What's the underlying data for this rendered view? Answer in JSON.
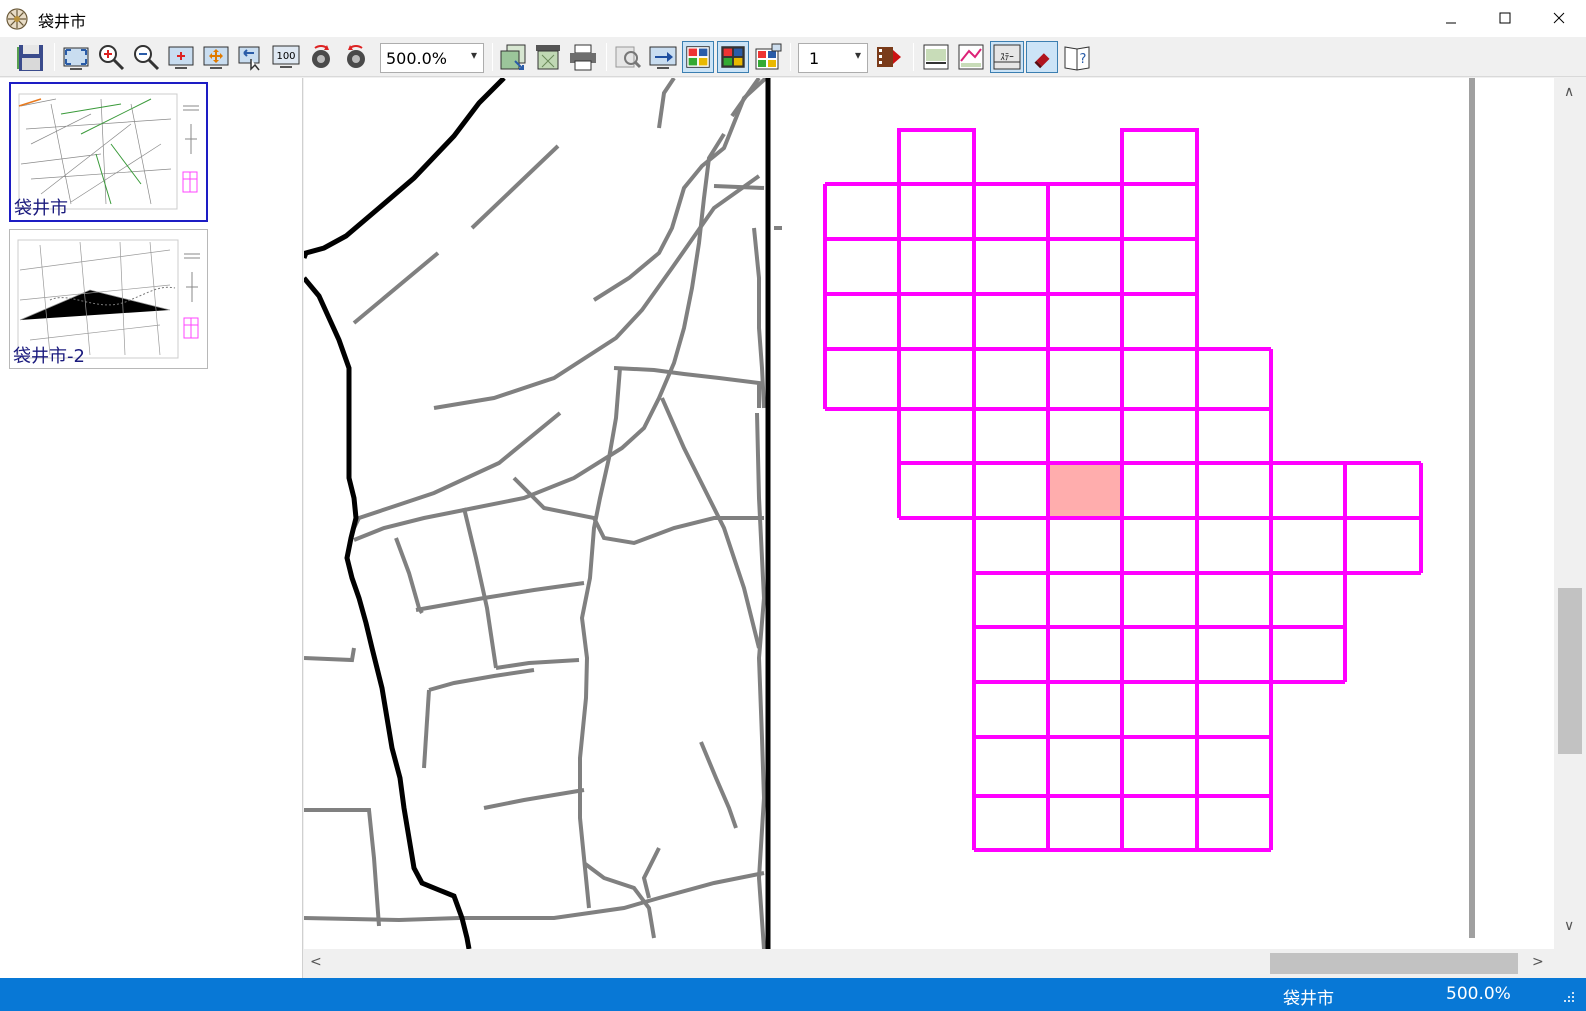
{
  "window": {
    "title": "袋井市",
    "minimize_glyph": "—",
    "maximize_glyph": "☐",
    "close_glyph": "✕"
  },
  "toolbar": {
    "buttons": [
      "save-icon",
      "fit-window-icon",
      "zoom-in-icon",
      "zoom-out-icon",
      "zoom-center-icon",
      "pan-icon",
      "zoom-previous-icon",
      "zoom-100-icon",
      "rotate-left-icon",
      "rotate-right-icon",
      "copy-icon",
      "print-preview-icon",
      "print-icon",
      "search-icon",
      "jump-icon",
      "layout-1-icon",
      "layout-2-icon",
      "layout-3-icon",
      "play-icon",
      "layer-1-icon",
      "layer-2-icon",
      "stamp-icon",
      "eraser-icon",
      "help-icon"
    ],
    "zoom_value": "500.0%",
    "page_value": "1",
    "stamp_label": "ｽﾃｰ"
  },
  "thumbnails": [
    {
      "label": "袋井市",
      "selected": true
    },
    {
      "label": "袋井市-2",
      "selected": false
    }
  ],
  "map": {
    "highlight_color": "#ffadad",
    "grid_color": "#ff00ff"
  },
  "scroll": {
    "up": "∧",
    "down": "∨",
    "left": "<",
    "right": ">"
  },
  "status": {
    "name": "袋井市",
    "zoom": "500.0%"
  }
}
